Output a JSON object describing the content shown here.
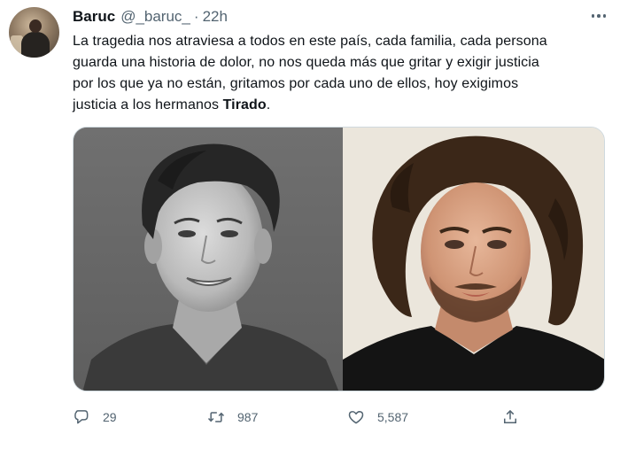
{
  "tweet": {
    "author": {
      "name": "Baruc",
      "handle": "@_baruc_",
      "separator": "·",
      "time": "22h"
    },
    "text_lines": [
      "La tragedia nos atraviesa a todos en este país, cada familia, cada persona",
      "guarda una historia de dolor, no nos queda más que gritar y exigir justicia",
      "por los que ya no están, gritamos por cada uno de ellos, hoy exigimos",
      "justicia a los hermanos "
    ],
    "text_bold": "Tirado",
    "text_end": ".",
    "media": {
      "count": 2,
      "left_photo": "portrait-black-and-white-smiling-young-man",
      "right_photo": "portrait-color-young-man-curly-hair-beard"
    },
    "stats": {
      "replies": "29",
      "retweets": "987",
      "likes": "5,587"
    },
    "icons": {
      "reply": "speech-bubble-icon",
      "retweet": "retweet-arrows-icon",
      "like": "heart-icon",
      "share": "share-upload-icon",
      "more": "more-dots-icon"
    },
    "colors": {
      "text": "#0f1419",
      "secondary": "#536471",
      "border": "#cfd9de",
      "background": "#ffffff"
    }
  }
}
